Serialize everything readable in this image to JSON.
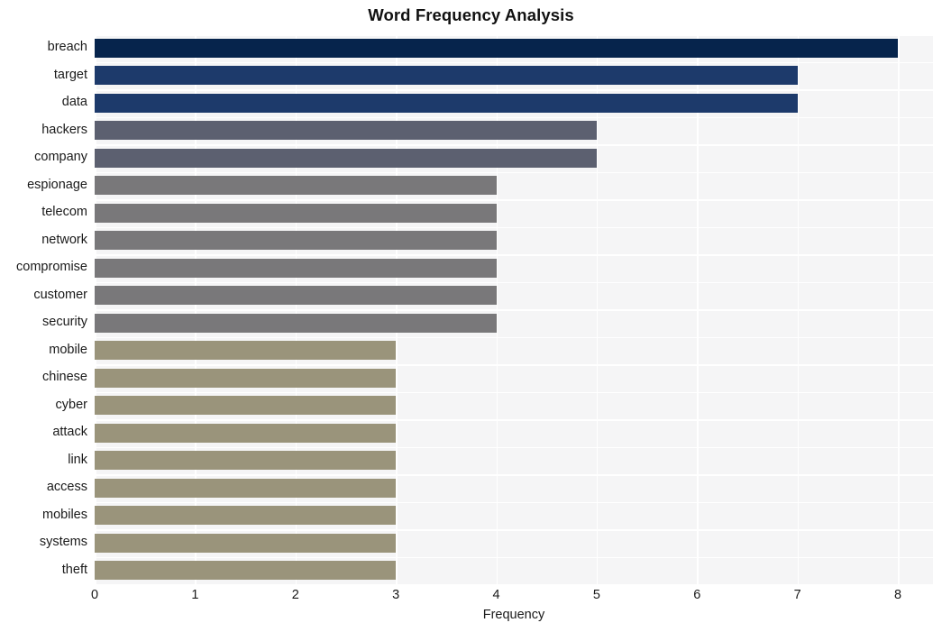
{
  "chart_data": {
    "type": "bar",
    "orientation": "horizontal",
    "title": "Word Frequency Analysis",
    "xlabel": "Frequency",
    "ylabel": "",
    "xlim": [
      0,
      8.35
    ],
    "xticks": [
      "0",
      "1",
      "2",
      "3",
      "4",
      "5",
      "6",
      "7",
      "8"
    ],
    "xtick_values": [
      0,
      1,
      2,
      3,
      4,
      5,
      6,
      7,
      8
    ],
    "grid": true,
    "legend": null,
    "categories": [
      "breach",
      "target",
      "data",
      "hackers",
      "company",
      "espionage",
      "telecom",
      "network",
      "compromise",
      "customer",
      "security",
      "mobile",
      "chinese",
      "cyber",
      "attack",
      "link",
      "access",
      "mobiles",
      "systems",
      "theft"
    ],
    "values": [
      8,
      7,
      7,
      5,
      5,
      4,
      4,
      4,
      4,
      4,
      4,
      3,
      3,
      3,
      3,
      3,
      3,
      3,
      3,
      3
    ],
    "bar_colors": [
      "#06244c",
      "#1d3a6b",
      "#1d3a6b",
      "#5c6070",
      "#5c6070",
      "#79787a",
      "#79787a",
      "#79787a",
      "#79787a",
      "#79787a",
      "#79787a",
      "#9a947b",
      "#9a947b",
      "#9a947b",
      "#9a947b",
      "#9a947b",
      "#9a947b",
      "#9a947b",
      "#9a947b",
      "#9a947b"
    ]
  },
  "style": {
    "plot_background": "#f5f5f6",
    "figure_background": "#ffffff",
    "gridline_color": "#ffffff",
    "text_color": "#1a1a1a",
    "title_color": "#111111"
  }
}
